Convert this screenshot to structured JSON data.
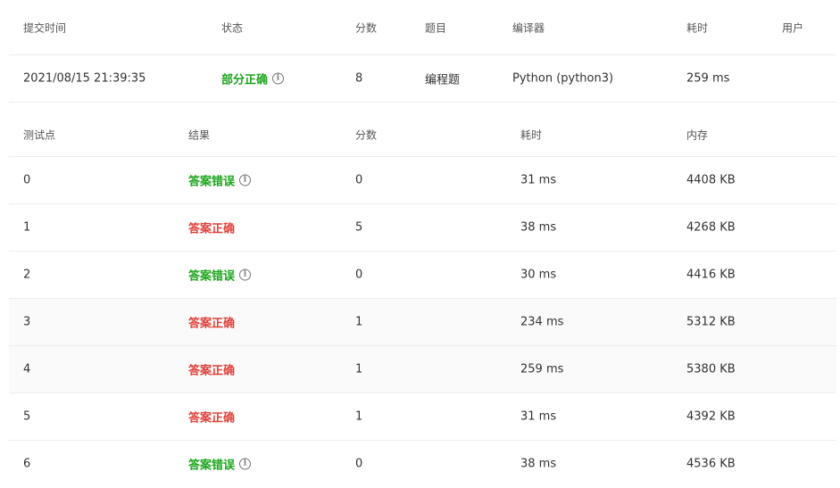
{
  "submission": {
    "headers": {
      "time": "提交时间",
      "status": "状态",
      "score": "分数",
      "problem": "题目",
      "compiler": "编译器",
      "duration": "耗时",
      "user": "用户"
    },
    "row": {
      "time": "2021/08/15 21:39:35",
      "status": "部分正确",
      "score": "8",
      "problem": "编程题",
      "compiler": "Python (python3)",
      "duration": "259 ms",
      "user": ""
    }
  },
  "testcases": {
    "headers": {
      "point": "测试点",
      "result": "结果",
      "score": "分数",
      "duration": "耗时",
      "memory": "内存"
    },
    "rows": [
      {
        "point": "0",
        "result": "答案错误",
        "score": "0",
        "duration": "31 ms",
        "memory": "4408 KB"
      },
      {
        "point": "1",
        "result": "答案正确",
        "score": "5",
        "duration": "38 ms",
        "memory": "4268 KB"
      },
      {
        "point": "2",
        "result": "答案错误",
        "score": "0",
        "duration": "30 ms",
        "memory": "4416 KB"
      },
      {
        "point": "3",
        "result": "答案正确",
        "score": "1",
        "duration": "234 ms",
        "memory": "5312 KB"
      },
      {
        "point": "4",
        "result": "答案正确",
        "score": "1",
        "duration": "259 ms",
        "memory": "5380 KB"
      },
      {
        "point": "5",
        "result": "答案正确",
        "score": "1",
        "duration": "31 ms",
        "memory": "4392 KB"
      },
      {
        "point": "6",
        "result": "答案错误",
        "score": "0",
        "duration": "38 ms",
        "memory": "4536 KB"
      }
    ]
  },
  "colors": {
    "wrong_answer": "#1ca51c",
    "accepted": "#e0413a",
    "partial": "#1ca51c"
  },
  "icons": {
    "info": "info-circle-icon"
  }
}
